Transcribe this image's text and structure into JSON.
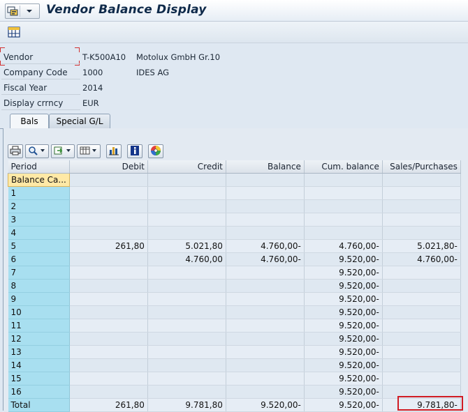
{
  "window": {
    "title": "Vendor Balance Display"
  },
  "header": {
    "fields": [
      {
        "label": "Vendor",
        "value": "T-K500A10",
        "value2": "Motolux GmbH Gr.10"
      },
      {
        "label": "Company Code",
        "value": "1000",
        "value2": "IDES AG"
      },
      {
        "label": "Fiscal Year",
        "value": "2014",
        "value2": ""
      },
      {
        "label": "Display crrncy",
        "value": "EUR",
        "value2": ""
      }
    ]
  },
  "tabs": [
    {
      "label": "Bals",
      "active": true
    },
    {
      "label": "Special G/L",
      "active": false
    }
  ],
  "toolbar": {
    "icons": [
      "print-icon",
      "find-icon",
      "export-icon",
      "layout-icon",
      "chart-icon",
      "info-icon",
      "color-wheel-icon"
    ]
  },
  "grid": {
    "columns": [
      "Period",
      "Debit",
      "Credit",
      "Balance",
      "Cum. balance",
      "Sales/Purchases"
    ],
    "rows": [
      {
        "period": "Balance Ca...",
        "debit": "",
        "credit": "",
        "balance": "",
        "cum": "",
        "sales": ""
      },
      {
        "period": "1",
        "debit": "",
        "credit": "",
        "balance": "",
        "cum": "",
        "sales": ""
      },
      {
        "period": "2",
        "debit": "",
        "credit": "",
        "balance": "",
        "cum": "",
        "sales": ""
      },
      {
        "period": "3",
        "debit": "",
        "credit": "",
        "balance": "",
        "cum": "",
        "sales": ""
      },
      {
        "period": "4",
        "debit": "",
        "credit": "",
        "balance": "",
        "cum": "",
        "sales": ""
      },
      {
        "period": "5",
        "debit": "261,80",
        "credit": "5.021,80",
        "balance": "4.760,00-",
        "cum": "4.760,00-",
        "sales": "5.021,80-"
      },
      {
        "period": "6",
        "debit": "",
        "credit": "4.760,00",
        "balance": "4.760,00-",
        "cum": "9.520,00-",
        "sales": "4.760,00-"
      },
      {
        "period": "7",
        "debit": "",
        "credit": "",
        "balance": "",
        "cum": "9.520,00-",
        "sales": ""
      },
      {
        "period": "8",
        "debit": "",
        "credit": "",
        "balance": "",
        "cum": "9.520,00-",
        "sales": ""
      },
      {
        "period": "9",
        "debit": "",
        "credit": "",
        "balance": "",
        "cum": "9.520,00-",
        "sales": ""
      },
      {
        "period": "10",
        "debit": "",
        "credit": "",
        "balance": "",
        "cum": "9.520,00-",
        "sales": ""
      },
      {
        "period": "11",
        "debit": "",
        "credit": "",
        "balance": "",
        "cum": "9.520,00-",
        "sales": ""
      },
      {
        "period": "12",
        "debit": "",
        "credit": "",
        "balance": "",
        "cum": "9.520,00-",
        "sales": ""
      },
      {
        "period": "13",
        "debit": "",
        "credit": "",
        "balance": "",
        "cum": "9.520,00-",
        "sales": ""
      },
      {
        "period": "14",
        "debit": "",
        "credit": "",
        "balance": "",
        "cum": "9.520,00-",
        "sales": ""
      },
      {
        "period": "15",
        "debit": "",
        "credit": "",
        "balance": "",
        "cum": "9.520,00-",
        "sales": ""
      },
      {
        "period": "16",
        "debit": "",
        "credit": "",
        "balance": "",
        "cum": "9.520,00-",
        "sales": ""
      },
      {
        "period": "Total",
        "debit": "261,80",
        "credit": "9.781,80",
        "balance": "9.520,00-",
        "cum": "9.520,00-",
        "sales": "9.781,80-"
      }
    ]
  },
  "colors": {
    "highlight": "#d01c24",
    "period_column": "#a8dff0",
    "selected_cell": "#ffe9a6"
  }
}
